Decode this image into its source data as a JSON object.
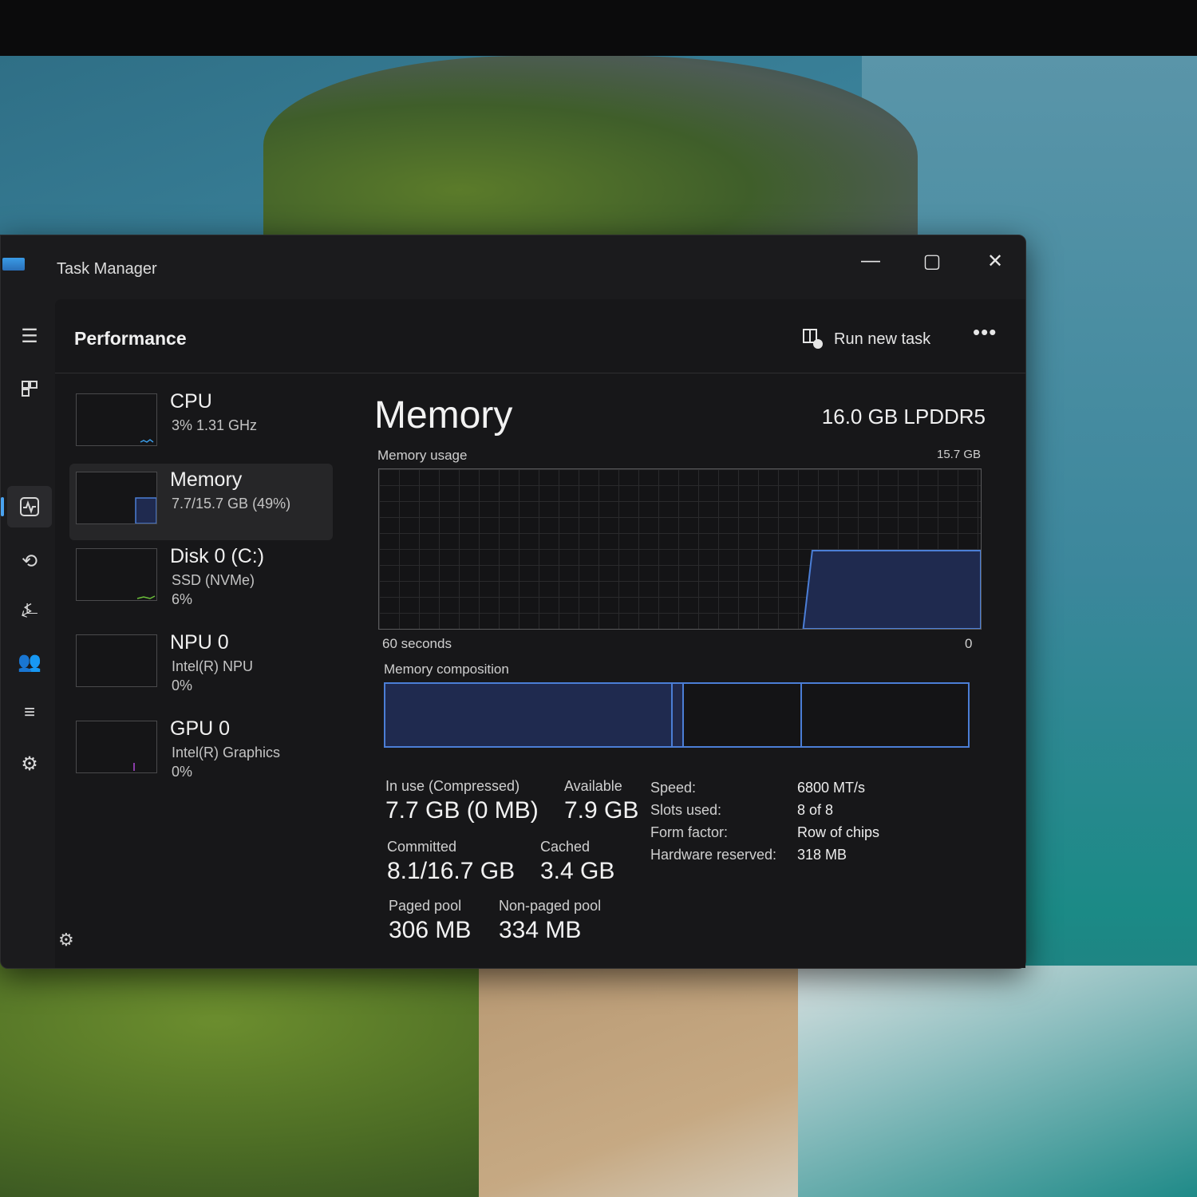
{
  "window": {
    "title": "Task Manager",
    "controls": {
      "minimize": "—",
      "maximize": "▢",
      "close": "✕"
    }
  },
  "header": {
    "title": "Performance",
    "run_new_task": "Run new task",
    "more": "•••"
  },
  "nav": [
    "hamburger-icon",
    "processes-icon",
    "performance-icon",
    "app-history-icon",
    "startup-icon",
    "users-icon",
    "details-icon",
    "services-icon"
  ],
  "devices": [
    {
      "name": "CPU",
      "sub": "3%  1.31 GHz",
      "sub2": ""
    },
    {
      "name": "Memory",
      "sub": "7.7/15.7 GB (49%)",
      "sub2": ""
    },
    {
      "name": "Disk 0 (C:)",
      "sub": "SSD (NVMe)",
      "sub2": "6%"
    },
    {
      "name": "NPU 0",
      "sub": "Intel(R) NPU",
      "sub2": "0%"
    },
    {
      "name": "GPU 0",
      "sub": "Intel(R) Graphics",
      "sub2": "0%"
    }
  ],
  "detail": {
    "title": "Memory",
    "type": "16.0 GB LPDDR5",
    "usage_label": "Memory usage",
    "usage_max": "15.7 GB",
    "time_label": "60 seconds",
    "zero": "0",
    "composition_label": "Memory composition",
    "usage_fraction": 0.49,
    "composition": {
      "in_use": 0.49,
      "standby": 0.2,
      "free": 0.31
    },
    "stats": {
      "in_use_label": "In use (Compressed)",
      "in_use_value": "7.7 GB (0 MB)",
      "available_label": "Available",
      "available_value": "7.9 GB",
      "committed_label": "Committed",
      "committed_value": "8.1/16.7 GB",
      "cached_label": "Cached",
      "cached_value": "3.4 GB",
      "paged_label": "Paged pool",
      "paged_value": "306 MB",
      "nonpaged_label": "Non-paged pool",
      "nonpaged_value": "334 MB"
    },
    "specs": {
      "speed_label": "Speed:",
      "speed_value": "6800 MT/s",
      "slots_label": "Slots used:",
      "slots_value": "8 of 8",
      "form_label": "Form factor:",
      "form_value": "Row of chips",
      "reserved_label": "Hardware reserved:",
      "reserved_value": "318 MB"
    }
  },
  "colors": {
    "accent": "#4aa3f0",
    "memory_line": "#4b7ed6",
    "memory_fill": "#1f2a4f"
  }
}
